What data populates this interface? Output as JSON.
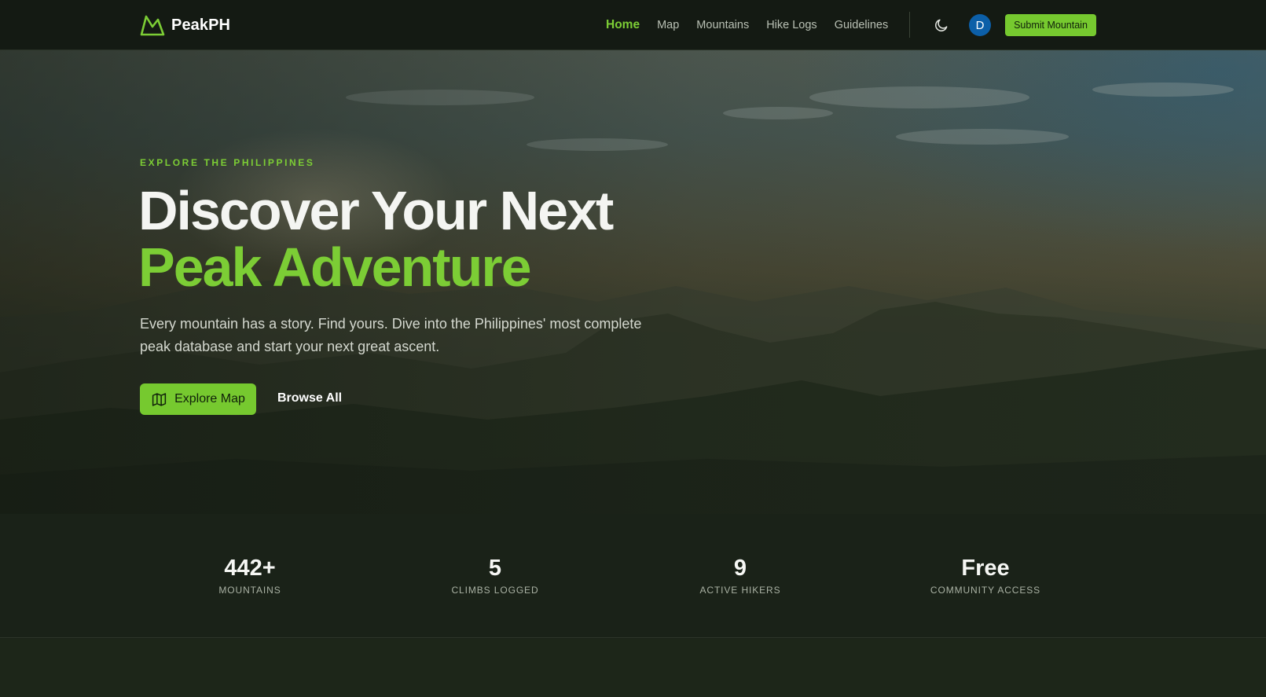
{
  "brand": {
    "name": "PeakPH",
    "logo_icon": "mountain-icon"
  },
  "nav": {
    "items": [
      {
        "label": "Home",
        "active": true
      },
      {
        "label": "Map",
        "active": false
      },
      {
        "label": "Mountains",
        "active": false
      },
      {
        "label": "Hike Logs",
        "active": false
      },
      {
        "label": "Guidelines",
        "active": false
      }
    ],
    "theme_icon": "moon-icon",
    "avatar_initial": "D",
    "submit_label": "Submit Mountain"
  },
  "hero": {
    "eyebrow": "EXPLORE THE PHILIPPINES",
    "headline_line1": "Discover Your Next",
    "headline_line2": "Peak Adventure",
    "subtitle": "Every mountain has a story. Find yours. Dive into the Philippines' most complete peak database and start your next great ascent.",
    "primary_button": {
      "label": "Explore Map",
      "icon": "map-icon"
    },
    "secondary_button": {
      "label": "Browse All"
    }
  },
  "stats": [
    {
      "value": "442+",
      "label": "MOUNTAINS"
    },
    {
      "value": "5",
      "label": "CLIMBS LOGGED"
    },
    {
      "value": "9",
      "label": "ACTIVE HIKERS"
    },
    {
      "value": "Free",
      "label": "COMMUNITY ACCESS"
    }
  ],
  "colors": {
    "accent": "#76c92f",
    "accent_text": "#7ccd35",
    "background": "#1a2218",
    "navbar": "#141a13",
    "avatar": "#0c5fa8"
  }
}
